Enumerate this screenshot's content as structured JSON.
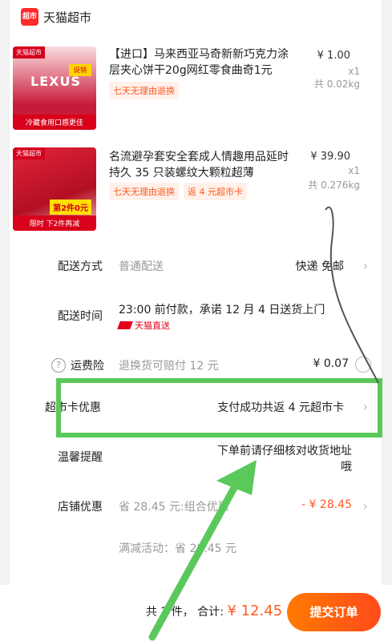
{
  "store": {
    "logo_text": "超市",
    "name": "天猫超市"
  },
  "products": [
    {
      "title": "【进口】马来西亚马奇新新巧克力涂层夹心饼干20g网红零食曲奇1元",
      "price": "¥ 1.00",
      "qty": "x1",
      "weight": "共 0.02kg",
      "tags": [
        "七天无理由退换"
      ],
      "thumb": {
        "tag": "天猫超市",
        "brand": "LEXUS",
        "sale": "促销",
        "foot": "冷藏食用口感更佳"
      }
    },
    {
      "title": "名流避孕套安全套成人情趣用品延时持久 35 只装螺纹大颗粒超薄",
      "price": "¥ 39.90",
      "qty": "x1",
      "weight": "共 0.276kg",
      "tags": [
        "七天无理由退换",
        "返 4 元超市卡"
      ],
      "thumb": {
        "tag": "天猫超市",
        "deal": "第2件0元",
        "foot": "限时 下2件再减"
      }
    }
  ],
  "delivery": {
    "label": "配送方式",
    "value": "普通配送",
    "right": "快递 免邮"
  },
  "time": {
    "label": "配送时间",
    "value": "23:00 前付款，承诺 12 月 4 日送货上门",
    "ship_label": "天猫直送"
  },
  "insurance": {
    "label": "运费险",
    "value": "退换货可赔付 12 元",
    "right": "¥ 0.07"
  },
  "card_promo": {
    "label": "超市卡优惠",
    "right": "支付成功共返 4 元超市卡"
  },
  "reminder": {
    "label": "温馨提醒",
    "line1": "下单前请仔细核对收货地址",
    "line2": "哦"
  },
  "shop_promo": {
    "label": "店铺优惠",
    "value": "省 28.45 元:组合优惠",
    "right": "- ¥ 28.45"
  },
  "discount": {
    "value": "满减活动：省 28.45 元"
  },
  "bottom": {
    "count": "共 2 件，",
    "total_label": "合计:",
    "total_amount": "¥ 12.45",
    "submit": "提交订单"
  },
  "annotation": {
    "highlight_color": "#5ac85a"
  }
}
